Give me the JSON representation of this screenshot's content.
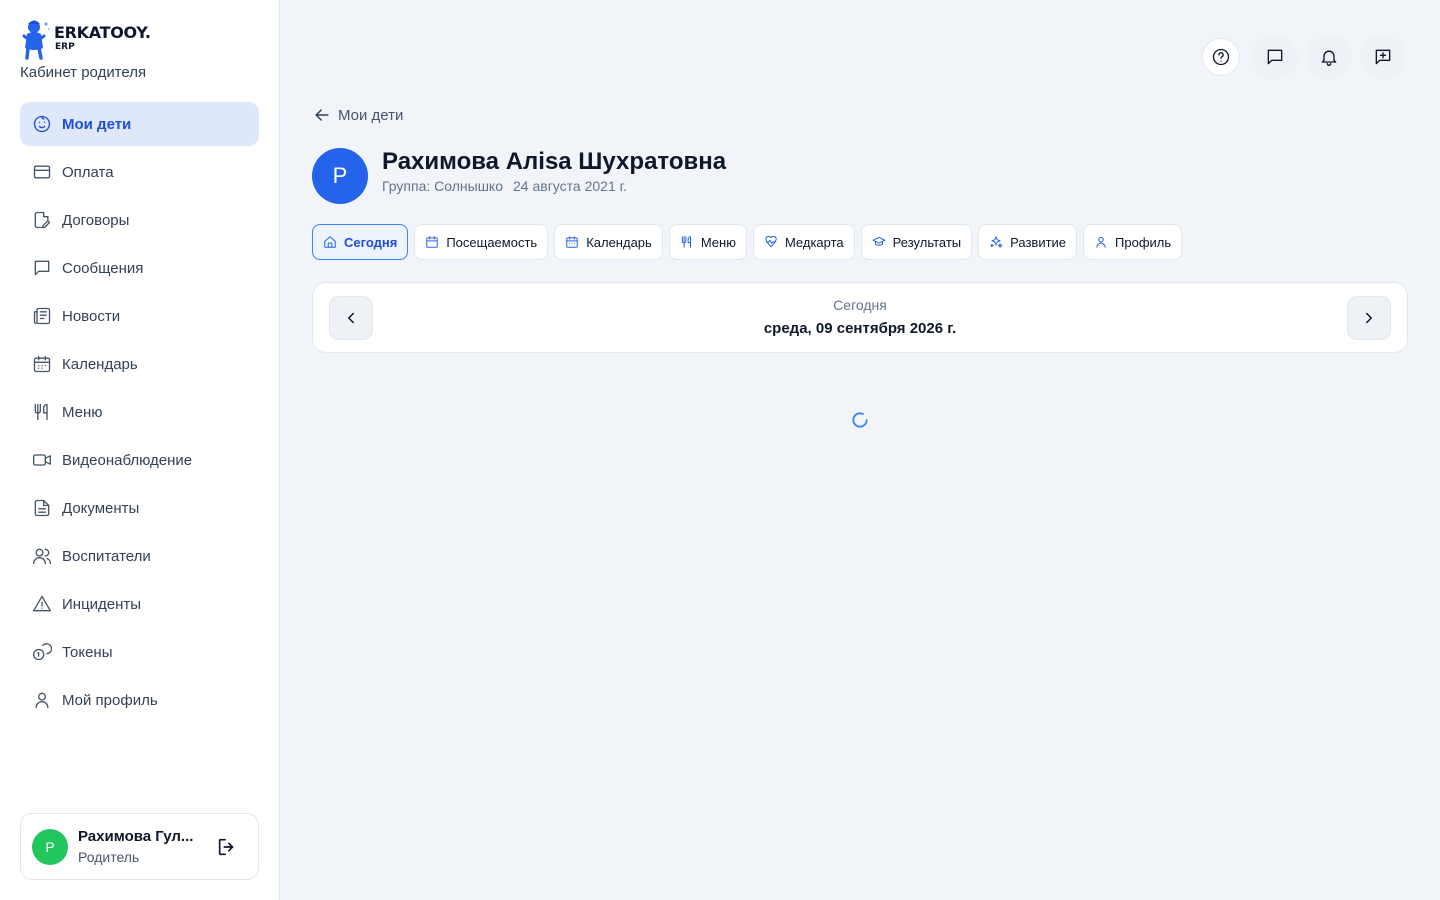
{
  "brand": {
    "name": "ERKATOOY.",
    "sub": "ERP",
    "cabinet": "Кабинет родителя"
  },
  "sidebar": {
    "items": [
      {
        "label": "Мои дети",
        "icon": "child-face-icon",
        "active": true
      },
      {
        "label": "Оплата",
        "icon": "credit-card-icon"
      },
      {
        "label": "Договоры",
        "icon": "contract-icon"
      },
      {
        "label": "Сообщения",
        "icon": "message-icon"
      },
      {
        "label": "Новости",
        "icon": "newspaper-icon"
      },
      {
        "label": "Календарь",
        "icon": "calendar-icon"
      },
      {
        "label": "Меню",
        "icon": "utensils-icon"
      },
      {
        "label": "Видеонаблюдение",
        "icon": "video-icon"
      },
      {
        "label": "Документы",
        "icon": "document-icon"
      },
      {
        "label": "Воспитатели",
        "icon": "users-icon"
      },
      {
        "label": "Инциденты",
        "icon": "warning-icon"
      },
      {
        "label": "Токены",
        "icon": "coins-icon"
      },
      {
        "label": "Мой профиль",
        "icon": "user-icon"
      }
    ]
  },
  "user": {
    "initial": "Р",
    "name": "Рахимова Гул...",
    "role": "Родитель"
  },
  "header": {
    "back_label": "Мои дети"
  },
  "child": {
    "initial": "Р",
    "name": "Рахимова Алisa Шухратовна",
    "group": "Группа: Солнышко",
    "birthdate": "24 августа 2021 г."
  },
  "tabs": [
    {
      "label": "Сегодня",
      "icon": "home-icon",
      "active": true
    },
    {
      "label": "Посещаемость",
      "icon": "calendar-check-icon"
    },
    {
      "label": "Календарь",
      "icon": "calendar-icon"
    },
    {
      "label": "Меню",
      "icon": "utensils-icon"
    },
    {
      "label": "Медкарта",
      "icon": "heart-pulse-icon"
    },
    {
      "label": "Результаты",
      "icon": "graduation-cap-icon"
    },
    {
      "label": "Развитие",
      "icon": "sparkles-icon"
    },
    {
      "label": "Профиль",
      "icon": "user-icon"
    }
  ],
  "day": {
    "label": "Сегодня",
    "date": "среда, 09 сентября 2026 г."
  },
  "colors": {
    "accent": "#2563eb",
    "active_bg": "#dfe7fb",
    "avatar_user": "#22c55e",
    "page_bg": "#f1f4f9"
  }
}
